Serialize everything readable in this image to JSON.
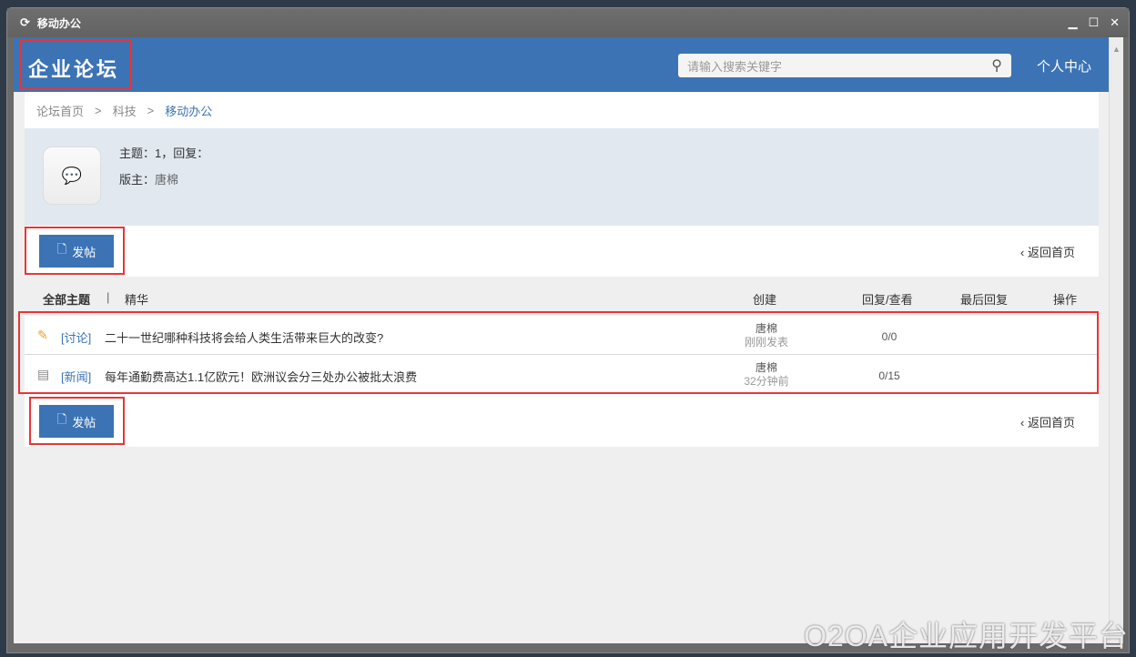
{
  "window": {
    "title": "移动办公",
    "controls": [
      "minimize",
      "maximize",
      "close"
    ]
  },
  "header": {
    "logo": "企业论坛",
    "search_placeholder": "请输入搜索关键字",
    "user_center": "个人中心"
  },
  "breadcrumb": [
    "论坛首页",
    "科技",
    "移动办公"
  ],
  "breadcrumb_sep": ">",
  "section": {
    "stats": "主题：1，回复：",
    "moderator_label": "版主：",
    "moderator": "唐棉"
  },
  "actions": {
    "post": "发帖",
    "back": "返回首页"
  },
  "tabs": {
    "all": "全部主题",
    "sep": "|",
    "featured": "精华"
  },
  "columns": {
    "created": "创建",
    "replies_views": "回复/查看",
    "last_reply": "最后回复",
    "ops": "操作"
  },
  "topics": [
    {
      "icon": "discussion-icon",
      "category": "[讨论]",
      "title": "二十一世纪哪种科技将会给人类生活带来巨大的改变?",
      "author": "唐棉",
      "time": "刚刚发表",
      "stats": "0/0"
    },
    {
      "icon": "news-icon",
      "category": "[新闻]",
      "title": "每年通勤费高达1.1亿欧元！欧洲议会分三处办公被批太浪费",
      "author": "唐棉",
      "time": "32分钟前",
      "stats": "0/15"
    }
  ],
  "watermark": "O2OA企业应用开发平台",
  "colors": {
    "primary": "#3b73b5",
    "highlight": "#ee3333"
  }
}
